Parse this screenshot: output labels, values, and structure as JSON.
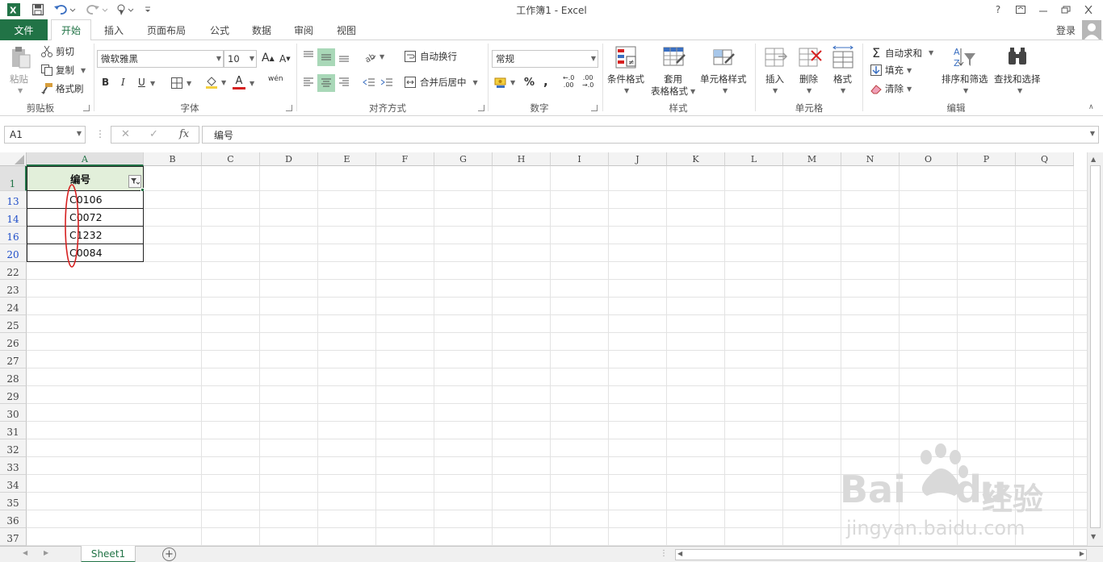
{
  "title_bar": {
    "title": "工作簿1 - Excel",
    "help": "?"
  },
  "tabs": {
    "file": "文件",
    "items": [
      "开始",
      "插入",
      "页面布局",
      "公式",
      "数据",
      "审阅",
      "视图"
    ],
    "active": "开始",
    "login": "登录"
  },
  "ribbon": {
    "clipboard": {
      "paste": "粘贴",
      "cut": "剪切",
      "copy": "复制",
      "format_painter": "格式刷",
      "label": "剪贴板"
    },
    "font": {
      "font_name": "微软雅黑",
      "font_size": "10",
      "bold": "B",
      "italic": "I",
      "underline": "U",
      "grow": "A",
      "shrink": "A",
      "font_color": "A",
      "phonetic": "wén",
      "label": "字体"
    },
    "alignment": {
      "wrap": "自动换行",
      "merge": "合并后居中",
      "label": "对齐方式"
    },
    "number": {
      "format": "常规",
      "percent": "%",
      "comma": ",",
      "inc_decimal": ".00",
      "dec_decimal": ".00",
      "label": "数字"
    },
    "styles": {
      "conditional": "条件格式",
      "table1": "套用",
      "table2": "表格格式",
      "cell_styles": "单元格样式",
      "label": "样式"
    },
    "cells": {
      "insert": "插入",
      "delete": "删除",
      "format": "格式",
      "label": "单元格"
    },
    "editing": {
      "autosum": "自动求和",
      "fill": "填充",
      "clear": "清除",
      "sort": "排序和筛选",
      "find": "查找和选择",
      "label": "编辑"
    }
  },
  "formula_bar": {
    "name_box": "A1",
    "fx": "fx",
    "cancel": "✕",
    "enter": "✓",
    "content": "编号"
  },
  "grid": {
    "columns": [
      "A",
      "B",
      "C",
      "D",
      "E",
      "F",
      "G",
      "H",
      "I",
      "J",
      "K",
      "L",
      "M",
      "N",
      "O",
      "P",
      "Q"
    ],
    "rows": [
      "1",
      "13",
      "14",
      "16",
      "20",
      "22",
      "23",
      "24",
      "25",
      "26",
      "27",
      "28",
      "29",
      "30",
      "31",
      "32",
      "33",
      "34",
      "35",
      "36",
      "37"
    ],
    "header_cell": "编号",
    "values": [
      "C0106",
      "C0072",
      "C1232",
      "C0084"
    ]
  },
  "sheets": {
    "active": "Sheet1",
    "add": "+"
  },
  "watermark": {
    "brand": "Bai",
    "brand2": "du",
    "cn": "经验",
    "url": "jingyan.baidu.com"
  },
  "colors": {
    "accent": "#217346",
    "filtered_row": "#1f4ec9",
    "annotation": "#d62020"
  }
}
